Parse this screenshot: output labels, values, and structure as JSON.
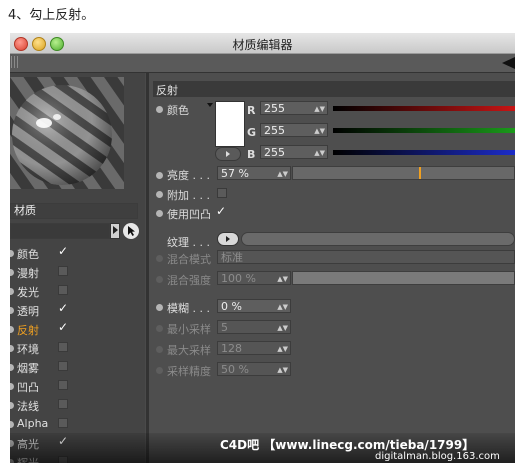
{
  "caption": "4、勾上反射。",
  "window": {
    "title": "材质编辑器"
  },
  "left_panel": {
    "material_name": "材质",
    "channels": [
      {
        "label": "颜色",
        "checked": true,
        "active": false
      },
      {
        "label": "漫射",
        "checked": false,
        "active": false
      },
      {
        "label": "发光",
        "checked": false,
        "active": false
      },
      {
        "label": "透明",
        "checked": true,
        "active": false
      },
      {
        "label": "反射",
        "checked": true,
        "active": true
      },
      {
        "label": "环境",
        "checked": false,
        "active": false
      },
      {
        "label": "烟雾",
        "checked": false,
        "active": false
      },
      {
        "label": "凹凸",
        "checked": false,
        "active": false
      },
      {
        "label": "法线",
        "checked": false,
        "active": false
      },
      {
        "label": "Alpha",
        "checked": false,
        "active": false
      },
      {
        "label": "高光",
        "checked": true,
        "active": false
      },
      {
        "label": "辉光",
        "checked": false,
        "active": false
      }
    ]
  },
  "reflection": {
    "section_title": "反射",
    "color_label": "颜色",
    "r_label": "R",
    "r_value": "255",
    "g_label": "G",
    "g_value": "255",
    "b_label": "B",
    "b_value": "255",
    "r_slider": 1.0,
    "g_slider": 1.0,
    "b_slider": 1.0,
    "brightness_label": "亮度 . . .",
    "brightness_value": "57 %",
    "brightness_slider": 0.57,
    "additive_label": "附加 . . .",
    "use_bump_label": "使用凹凸",
    "texture_label": "纹理 . . .",
    "blend_mode_label": "混合模式",
    "blend_mode_value": "标准",
    "blend_strength_label": "混合强度",
    "blend_strength_value": "100 %",
    "blur_label": "模糊 . . .",
    "blur_value": "0 %",
    "min_samples_label": "最小采样",
    "min_samples_value": "5",
    "max_samples_label": "最大采样",
    "max_samples_value": "128",
    "sample_accuracy_label": "采样精度",
    "sample_accuracy_value": "50 %"
  },
  "colors": {
    "accent_orange": "#f0a020",
    "active_channel": "#f0a020",
    "red_channel": "#c81414",
    "green_channel": "#1a9a1a",
    "blue_channel": "#1c2cc8"
  },
  "watermark": {
    "main": "C4D吧 【www.linecg.com/tieba/1799】",
    "sub": "digitalman.blog.163.com"
  }
}
